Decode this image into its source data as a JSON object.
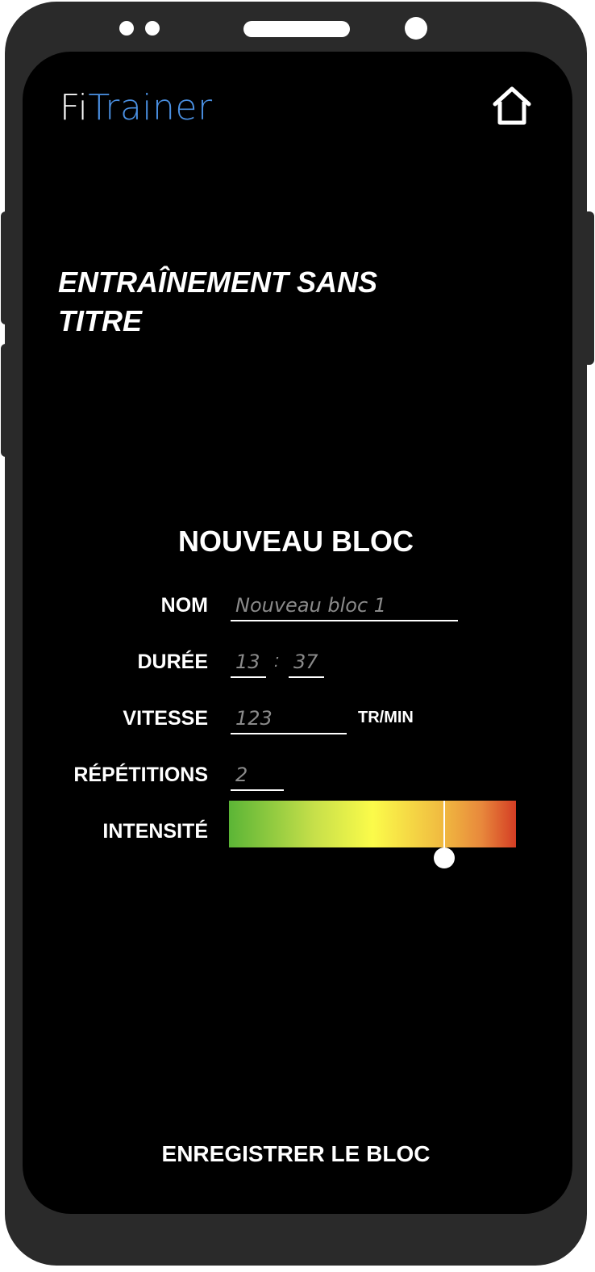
{
  "app": {
    "brand_prefix": "Fi",
    "brand_accent": "Trainer",
    "accent_color": "#4a90e2"
  },
  "header": {
    "home_icon": "home-icon"
  },
  "workout": {
    "title": "ENTRAÎNEMENT SANS TITRE"
  },
  "block_form": {
    "title": "NOUVEAU BLOC",
    "name": {
      "label": "NOM",
      "placeholder": "Nouveau bloc 1"
    },
    "duration": {
      "label": "DURÉE",
      "minutes_placeholder": "13",
      "separator": ":",
      "seconds_placeholder": "37"
    },
    "speed": {
      "label": "VITESSE",
      "placeholder": "123",
      "unit": "TR/MIN"
    },
    "repetitions": {
      "label": "RÉPÉTITIONS",
      "placeholder": "2"
    },
    "intensity": {
      "label": "INTENSITÉ",
      "level": 0.75
    }
  },
  "footer": {
    "save_label": "ENREGISTRER LE BLOC"
  }
}
